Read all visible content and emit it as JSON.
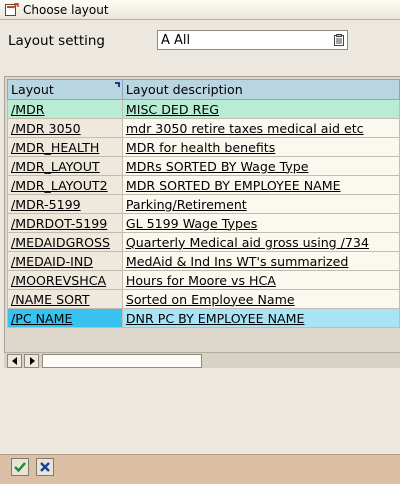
{
  "window": {
    "title": "Choose layout"
  },
  "setting": {
    "label": "Layout setting",
    "value": "A All"
  },
  "table": {
    "columns": [
      "Layout",
      "Layout description"
    ],
    "rows": [
      {
        "layout": "/MDR",
        "description": "MISC DED REG",
        "state": "highlighted-green"
      },
      {
        "layout": "/MDR 3050",
        "description": "mdr 3050 retire taxes medical aid etc"
      },
      {
        "layout": "/MDR_HEALTH",
        "description": "MDR for health benefits"
      },
      {
        "layout": "/MDR_LAYOUT",
        "description": "MDRs SORTED BY Wage Type"
      },
      {
        "layout": "/MDR_LAYOUT2",
        "description": "MDR SORTED BY EMPLOYEE NAME"
      },
      {
        "layout": "/MDR-5199",
        "description": "Parking/Retirement"
      },
      {
        "layout": "/MDRDOT-5199",
        "description": "GL 5199 Wage Types"
      },
      {
        "layout": "/MEDAIDGROSS",
        "description": "Quarterly Medical aid gross using /734"
      },
      {
        "layout": "/MEDAID-IND",
        "description": "MedAid & Ind Ins WT's summarized"
      },
      {
        "layout": "/MOOREVSHCA",
        "description": "Hours for Moore vs HCA"
      },
      {
        "layout": "/NAME SORT",
        "description": "Sorted on Employee Name"
      },
      {
        "layout": "/PC NAME",
        "description": "DNR PC BY EMPLOYEE NAME",
        "state": "selected"
      }
    ]
  },
  "footer": {
    "confirm_icon": "checkmark-icon",
    "cancel_icon": "cancel-x-icon"
  },
  "colors": {
    "header": "#b9d5e2",
    "selected_key": "#38c2f0",
    "selected_text": "#a8e4f8",
    "highlight_green": "#b8ecd4",
    "footer": "#dcc0a6",
    "confirm": "#1f8a2a",
    "cancel": "#1c3f9a"
  }
}
